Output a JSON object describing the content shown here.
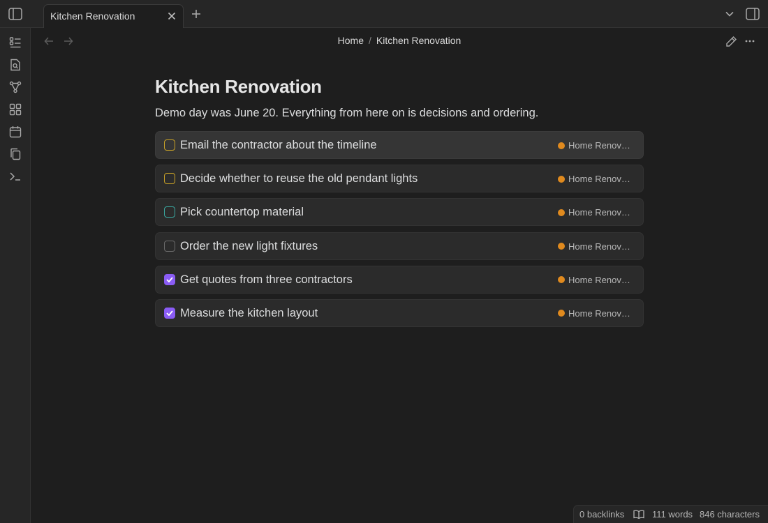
{
  "tab": {
    "title": "Kitchen Renovation"
  },
  "breadcrumb": {
    "parent": "Home",
    "separator": "/",
    "current": "Kitchen Renovation"
  },
  "note": {
    "title": "Kitchen Renovation",
    "description": "Demo day was June 20. Everything from here on is decisions and ordering."
  },
  "tasks": [
    {
      "label": "Email the contractor about the timeline",
      "done": false,
      "check_color": "#c9a227",
      "tag": "Home Renovation",
      "tag_color": "#e08a1e"
    },
    {
      "label": "Decide whether to reuse the old pendant lights",
      "done": false,
      "check_color": "#c9a227",
      "tag": "Home Renovation",
      "tag_color": "#e08a1e"
    },
    {
      "label": "Pick countertop material",
      "done": false,
      "check_color": "#3aa8a0",
      "tag": "Home Renovation",
      "tag_color": "#e08a1e"
    },
    {
      "label": "Order the new light fixtures",
      "done": false,
      "check_color": "#6b6b6b",
      "tag": "Home Renovation",
      "tag_color": "#e08a1e"
    },
    {
      "label": "Get quotes from three contractors",
      "done": true,
      "check_color": "#8a5cf5",
      "tag": "Home Renovation",
      "tag_color": "#e08a1e"
    },
    {
      "label": "Measure the kitchen layout",
      "done": true,
      "check_color": "#8a5cf5",
      "tag": "Home Renovation",
      "tag_color": "#e08a1e"
    }
  ],
  "status": {
    "backlinks": "0 backlinks",
    "words": "111 words",
    "characters": "846 characters"
  },
  "icons": {
    "ribbon": [
      "file-explorer-icon",
      "search-file-icon",
      "graph-icon",
      "canvas-icon",
      "calendar-icon",
      "copy-icon",
      "terminal-icon"
    ]
  },
  "colors": {
    "accent": "#8a5cf5",
    "tag": "#e08a1e",
    "background": "#1e1e1e"
  }
}
